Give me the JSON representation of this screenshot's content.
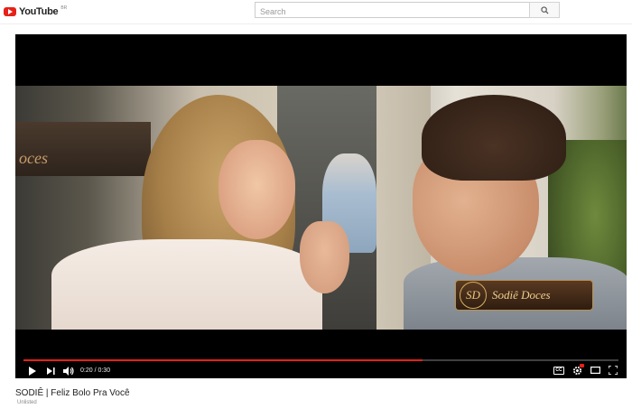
{
  "header": {
    "logo_text": "YouTube",
    "logo_region": "BR",
    "search_placeholder": "Search"
  },
  "player": {
    "brand_mark": "SD",
    "brand_name": "Sodiê Doces",
    "awning_text": "oces",
    "time_current": "0:20",
    "time_separator": " / ",
    "time_total": "0:30",
    "progress": 0.67,
    "cc_label": "CC"
  },
  "video": {
    "title": "SODIÊ | Feliz Bolo Pra Você",
    "status": "Unlisted"
  },
  "colors": {
    "accent": "#e62117",
    "player_bg": "#000000"
  }
}
